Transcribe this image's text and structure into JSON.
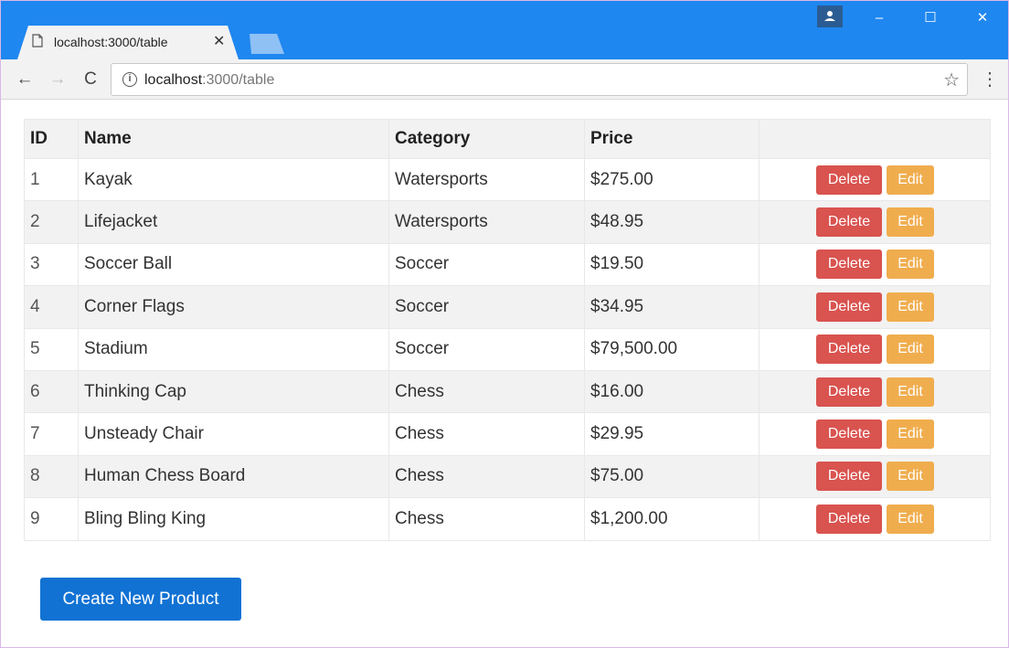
{
  "browser": {
    "tab_title": "localhost:3000/table",
    "url_host": "localhost",
    "url_rest": ":3000/table",
    "window_controls": {
      "minimize": "–",
      "maximize": "☐",
      "close": "✕"
    }
  },
  "table": {
    "headers": [
      "ID",
      "Name",
      "Category",
      "Price",
      ""
    ],
    "rows": [
      {
        "id": "1",
        "name": "Kayak",
        "category": "Watersports",
        "price": "$275.00"
      },
      {
        "id": "2",
        "name": "Lifejacket",
        "category": "Watersports",
        "price": "$48.95"
      },
      {
        "id": "3",
        "name": "Soccer Ball",
        "category": "Soccer",
        "price": "$19.50"
      },
      {
        "id": "4",
        "name": "Corner Flags",
        "category": "Soccer",
        "price": "$34.95"
      },
      {
        "id": "5",
        "name": "Stadium",
        "category": "Soccer",
        "price": "$79,500.00"
      },
      {
        "id": "6",
        "name": "Thinking Cap",
        "category": "Chess",
        "price": "$16.00"
      },
      {
        "id": "7",
        "name": "Unsteady Chair",
        "category": "Chess",
        "price": "$29.95"
      },
      {
        "id": "8",
        "name": "Human Chess Board",
        "category": "Chess",
        "price": "$75.00"
      },
      {
        "id": "9",
        "name": "Bling Bling King",
        "category": "Chess",
        "price": "$1,200.00"
      }
    ],
    "delete_label": "Delete",
    "edit_label": "Edit"
  },
  "create_button_label": "Create New Product",
  "colors": {
    "titlebar": "#1f87f0",
    "delete": "#d9534f",
    "edit": "#f0ad4e",
    "primary": "#1172d3"
  }
}
